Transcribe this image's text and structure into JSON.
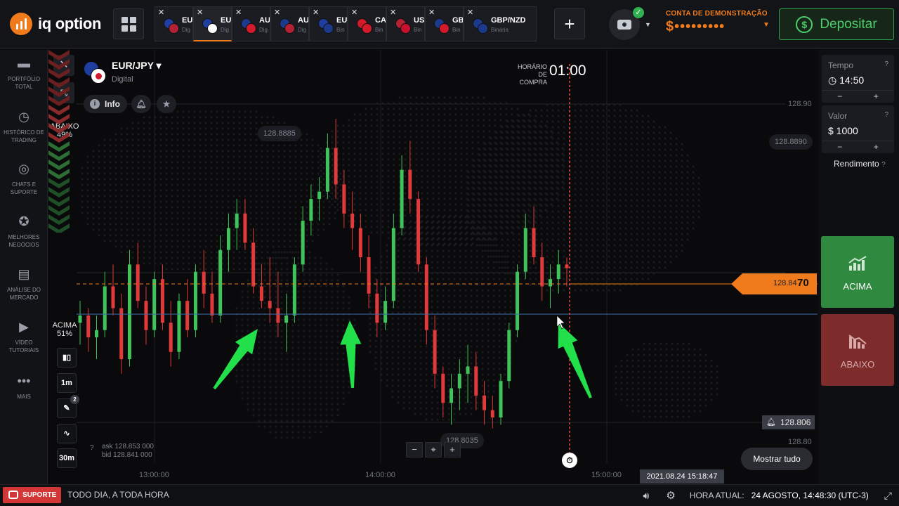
{
  "brand": {
    "name": "iq option"
  },
  "tabs": [
    {
      "name": "EU",
      "sub": "Dig",
      "flag_a": "#1f3fa0",
      "flag_b": "#b22234",
      "active": false
    },
    {
      "name": "EU",
      "sub": "Dig",
      "flag_a": "#1f3fa0",
      "flag_b": "#ffffff",
      "active": true
    },
    {
      "name": "AU",
      "sub": "Dig",
      "flag_a": "#1b3a8c",
      "flag_b": "#d11a2a",
      "active": false
    },
    {
      "name": "AU",
      "sub": "Dig",
      "flag_a": "#1b3a8c",
      "flag_b": "#b22234",
      "active": false
    },
    {
      "name": "EU",
      "sub": "Bin",
      "flag_a": "#1f3fa0",
      "flag_b": "#1b3a8c",
      "active": false
    },
    {
      "name": "CA",
      "sub": "Bin",
      "flag_a": "#d11a2a",
      "flag_b": "#d11a2a",
      "active": false
    },
    {
      "name": "US",
      "sub": "Bin",
      "flag_a": "#b22234",
      "flag_b": "#c8102e",
      "active": false
    },
    {
      "name": "GB",
      "sub": "Bin",
      "flag_a": "#1b3a8c",
      "flag_b": "#d11a2a",
      "active": false
    },
    {
      "name": "GBP/NZD",
      "sub": "Binária",
      "flag_a": "#1b3a8c",
      "flag_b": "#1b3a8c",
      "active": false
    }
  ],
  "account": {
    "label": "CONTA DE DEMONSTRAÇÃO",
    "balance": "$•••••••••"
  },
  "deposit": {
    "label": "Depositar",
    "icon": "dollar-refresh-icon"
  },
  "sidebar": [
    {
      "label": "PORTFÓLIO TOTAL",
      "icon": "briefcase-icon",
      "glyph": "▬"
    },
    {
      "label": "HISTÓRICO DE TRADING",
      "icon": "history-icon",
      "glyph": "◷"
    },
    {
      "label": "CHATS E SUPORTE",
      "icon": "chat-icon",
      "glyph": "◎"
    },
    {
      "label": "MELHORES NEGÓCIOS",
      "icon": "medal-icon",
      "glyph": "✪"
    },
    {
      "label": "ANÁLISE DO MERCADO",
      "icon": "newspaper-icon",
      "glyph": "▤"
    },
    {
      "label": "VÍDEO TUTORIAIS",
      "icon": "play-icon",
      "glyph": "▶"
    },
    {
      "label": "MAIS",
      "icon": "more-icon",
      "glyph": "•••"
    }
  ],
  "asset": {
    "name": "EUR/JPY",
    "type": "Digital"
  },
  "chips": {
    "info": "Info"
  },
  "sentiment": {
    "down_label": "ABAIXO",
    "down_pct": "49%",
    "up_label": "ACIMA",
    "up_pct": "51%"
  },
  "tools": {
    "timeframe": "1m",
    "expiry": "30m",
    "drawings_badge": "2"
  },
  "quote": {
    "ask": "ask 128.853 000",
    "bid": "bid 128.841 000"
  },
  "purchase_time": {
    "label": "HORÁRIO DE COMPRA",
    "value": "01:00"
  },
  "chart_data": {
    "type": "candlestick",
    "instrument": "EUR/JPY",
    "price_levels": [
      "128.90",
      "128.8890",
      "128.80"
    ],
    "max_label": "128.8885",
    "min_label": "128.8035",
    "current_price_prefix": "128.84",
    "current_price_suffix": "70",
    "alert_level": "128.806",
    "time_labels": [
      "13:00:00",
      "14:00:00",
      "15:00:00"
    ],
    "cursor_datetime": "2021.08.24 15:18:47",
    "ohlc": [
      [
        128.832,
        128.838,
        128.826,
        128.834
      ],
      [
        128.834,
        128.836,
        128.824,
        128.828
      ],
      [
        128.828,
        128.834,
        128.822,
        128.83
      ],
      [
        128.83,
        128.846,
        128.828,
        128.842
      ],
      [
        128.842,
        128.848,
        128.834,
        128.836
      ],
      [
        128.836,
        128.84,
        128.818,
        128.822
      ],
      [
        128.822,
        128.852,
        128.82,
        128.848
      ],
      [
        128.848,
        128.854,
        128.836,
        128.838
      ],
      [
        128.838,
        128.842,
        128.826,
        128.83
      ],
      [
        128.83,
        128.846,
        128.828,
        128.844
      ],
      [
        128.844,
        128.848,
        128.83,
        128.832
      ],
      [
        128.832,
        128.838,
        128.82,
        128.824
      ],
      [
        128.824,
        128.84,
        128.822,
        128.838
      ],
      [
        128.838,
        128.844,
        128.828,
        128.83
      ],
      [
        128.83,
        128.848,
        128.828,
        128.846
      ],
      [
        128.846,
        128.852,
        128.836,
        128.84
      ],
      [
        128.84,
        128.846,
        128.832,
        128.834
      ],
      [
        128.834,
        128.856,
        128.832,
        128.852
      ],
      [
        128.852,
        128.862,
        128.846,
        128.858
      ],
      [
        128.858,
        128.866,
        128.852,
        128.862
      ],
      [
        128.862,
        128.866,
        128.852,
        128.854
      ],
      [
        128.854,
        128.858,
        128.84,
        128.842
      ],
      [
        128.842,
        128.848,
        128.836,
        128.838
      ],
      [
        128.838,
        128.85,
        128.832,
        128.836
      ],
      [
        128.836,
        128.846,
        128.828,
        128.832
      ],
      [
        128.832,
        128.84,
        128.824,
        128.834
      ],
      [
        128.834,
        128.85,
        128.832,
        128.848
      ],
      [
        128.848,
        128.864,
        128.846,
        128.86
      ],
      [
        128.86,
        128.87,
        128.856,
        128.866
      ],
      [
        128.866,
        128.872,
        128.86,
        128.868
      ],
      [
        128.868,
        128.884,
        128.866,
        128.88
      ],
      [
        128.88,
        128.888,
        128.866,
        128.87
      ],
      [
        128.87,
        128.874,
        128.858,
        128.862
      ],
      [
        128.862,
        128.868,
        128.852,
        128.858
      ],
      [
        128.858,
        128.862,
        128.846,
        128.85
      ],
      [
        128.85,
        128.856,
        128.836,
        128.84
      ],
      [
        128.84,
        128.844,
        128.828,
        128.832
      ],
      [
        128.832,
        128.842,
        128.83,
        128.838
      ],
      [
        128.838,
        128.862,
        128.836,
        128.858
      ],
      [
        128.858,
        128.878,
        128.856,
        128.874
      ],
      [
        128.874,
        128.882,
        128.862,
        128.866
      ],
      [
        128.866,
        128.868,
        128.846,
        128.848
      ],
      [
        128.848,
        128.85,
        128.826,
        128.83
      ],
      [
        128.83,
        128.834,
        128.814,
        128.818
      ],
      [
        128.818,
        128.82,
        128.806,
        128.81
      ],
      [
        128.81,
        128.818,
        128.804,
        128.814
      ],
      [
        128.814,
        128.822,
        128.808,
        128.818
      ],
      [
        128.818,
        128.826,
        128.81,
        128.82
      ],
      [
        128.82,
        128.824,
        128.808,
        128.812
      ],
      [
        128.812,
        128.816,
        128.804,
        128.808
      ],
      [
        128.808,
        128.812,
        128.803,
        128.806
      ],
      [
        128.806,
        128.818,
        128.804,
        128.816
      ],
      [
        128.816,
        128.832,
        128.814,
        128.83
      ],
      [
        128.83,
        128.848,
        128.828,
        128.846
      ],
      [
        128.846,
        128.862,
        128.844,
        128.858
      ],
      [
        128.858,
        128.864,
        128.848,
        128.85
      ],
      [
        128.85,
        128.854,
        128.838,
        128.842
      ],
      [
        128.842,
        128.848,
        128.836,
        128.844
      ],
      [
        128.844,
        128.852,
        128.84,
        128.848
      ],
      [
        128.848,
        128.85,
        128.842,
        128.847
      ]
    ]
  },
  "markers": {
    "mostrar_tudo": "Mostrar tudo"
  },
  "right_panel": {
    "time_label": "Tempo",
    "time_value": "14:50",
    "amount_label": "Valor",
    "amount_value": "$ 1000",
    "yield_label": "Rendimento",
    "up_label": "ACIMA",
    "down_label": "ABAIXO"
  },
  "bottom": {
    "support": "SUPORTE",
    "tagline": "TODO DIA, A TODA HORA",
    "current_time_label": "HORA ATUAL:",
    "current_time_value": "24 AGOSTO, 14:48:30 (UTC-3)"
  },
  "colors": {
    "accent": "#f07b1c",
    "up": "#2fa04a",
    "down": "#d33636",
    "bull_candle": "#3fc35a",
    "bear_candle": "#e03a3a",
    "arrow": "#22e04a"
  }
}
